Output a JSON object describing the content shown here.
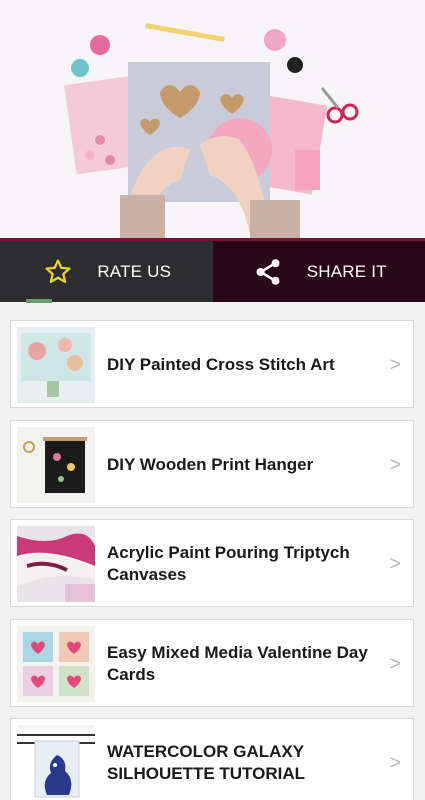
{
  "hero": {
    "icon": "craft-photo"
  },
  "actions": {
    "rate_label": "RATE US",
    "share_label": "SHARE IT",
    "rate_icon": "star-icon",
    "share_icon": "share-icon",
    "star_color": "#e8d431"
  },
  "items": [
    {
      "title": "DIY Painted Cross Stitch Art"
    },
    {
      "title": "DIY Wooden Print Hanger"
    },
    {
      "title": "Acrylic Paint Pouring Triptych Canvases"
    },
    {
      "title": "Easy Mixed Media Valentine Day Cards"
    },
    {
      "title": "WATERCOLOR GALAXY SILHOUETTE TUTORIAL"
    }
  ],
  "chevron": ">"
}
